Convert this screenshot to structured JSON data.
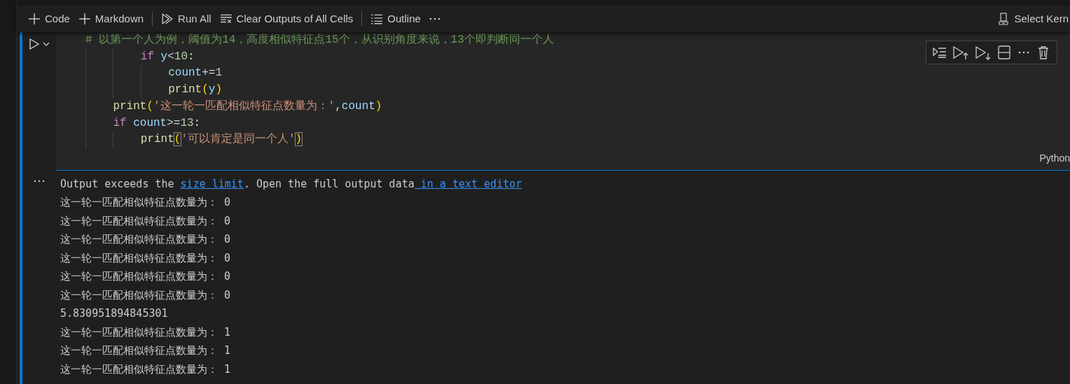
{
  "toolbar": {
    "items": [
      {
        "kind": "button",
        "label": "Code"
      },
      {
        "kind": "button",
        "label": "Markdown"
      },
      {
        "kind": "separator"
      },
      {
        "kind": "button",
        "label": "Run All"
      },
      {
        "kind": "button",
        "label": "Clear Outputs of All Cells"
      },
      {
        "kind": "separator"
      },
      {
        "kind": "button",
        "label": "Outline"
      },
      {
        "kind": "more"
      }
    ],
    "kernel": "Select Kern"
  },
  "cell": {
    "language": "Python",
    "lines": [
      {
        "tokens": [
          {
            "kind": "comment",
            "text": "# 以第一个人为例，阈值为14，高度相似特征点15个，从识别角度来说，13个即判断同一个人"
          }
        ],
        "children": [
          {
            "children": [
              {
                "tokens": [
                  {
                    "kind": "keyword",
                    "text": "if"
                  },
                  {
                    "kind": "variable",
                    "text": " y"
                  },
                  {
                    "kind": "plain",
                    "text": "<"
                  },
                  {
                    "kind": "number",
                    "text": "10"
                  },
                  {
                    "kind": "plain",
                    "text": ":"
                  }
                ],
                "children": [
                  {
                    "tokens": [
                      {
                        "kind": "variable",
                        "text": "count"
                      },
                      {
                        "kind": "plain",
                        "text": "+="
                      },
                      {
                        "kind": "number",
                        "text": "1"
                      }
                    ]
                  },
                  {
                    "tokens": [
                      {
                        "kind": "function",
                        "text": "print"
                      },
                      {
                        "kind": "bracket",
                        "text": "("
                      },
                      {
                        "kind": "variable",
                        "text": "y"
                      },
                      {
                        "kind": "bracket",
                        "text": ")"
                      }
                    ]
                  }
                ]
              }
            ]
          },
          {
            "tokens": [
              {
                "kind": "function",
                "text": "print"
              },
              {
                "kind": "bracket",
                "text": "("
              },
              {
                "kind": "string",
                "text": "'这一轮一匹配相似特征点数量为：'"
              },
              {
                "kind": "plain",
                "text": ","
              },
              {
                "kind": "variable",
                "text": "count"
              },
              {
                "kind": "bracket",
                "text": ")"
              }
            ]
          },
          {
            "tokens": [
              {
                "kind": "keyword",
                "text": "if"
              },
              {
                "kind": "variable",
                "text": " count"
              },
              {
                "kind": "plain",
                "text": ">="
              },
              {
                "kind": "number",
                "text": "13"
              },
              {
                "kind": "plain",
                "text": ":"
              }
            ],
            "children": [
              {
                "tokens": [
                  {
                    "kind": "function",
                    "text": "print"
                  },
                  {
                    "kind": "matched",
                    "text": "("
                  },
                  {
                    "kind": "string",
                    "text": "'可以肯定是同一个人'"
                  },
                  {
                    "kind": "matched",
                    "text": ")"
                  }
                ]
              }
            ]
          }
        ]
      }
    ]
  },
  "output": {
    "notice": [
      {
        "kind": "text",
        "text": "Output exceeds the "
      },
      {
        "kind": "link",
        "text": "size limit"
      },
      {
        "kind": "text",
        "text": ". Open the full output data"
      },
      {
        "kind": "link",
        "text": " in a text editor"
      }
    ],
    "lines": [
      "这一轮一匹配相似特征点数量为： 0",
      "这一轮一匹配相似特征点数量为： 0",
      "这一轮一匹配相似特征点数量为： 0",
      "这一轮一匹配相似特征点数量为： 0",
      "这一轮一匹配相似特征点数量为： 0",
      "这一轮一匹配相似特征点数量为： 0",
      "5.830951894845301",
      "这一轮一匹配相似特征点数量为： 1",
      "这一轮一匹配相似特征点数量为： 1",
      "这一轮一匹配相似特征点数量为： 1"
    ]
  }
}
